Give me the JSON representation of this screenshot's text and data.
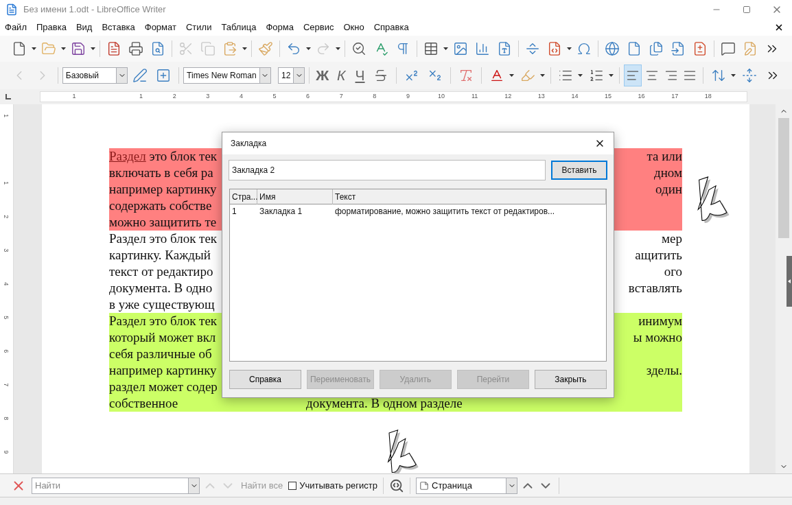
{
  "window": {
    "title": "Без имени 1.odt - LibreOffice Writer"
  },
  "menu": [
    "Файл",
    "Правка",
    "Вид",
    "Вставка",
    "Формат",
    "Стили",
    "Таблица",
    "Форма",
    "Сервис",
    "Окно",
    "Справка"
  ],
  "formatting": {
    "style": "Базовый",
    "font": "Times New Roman",
    "size": "12",
    "letters": [
      "Ж",
      "К",
      "Ч"
    ],
    "alignment": [
      {
        "kind": "left",
        "selected": true
      },
      {
        "kind": "center",
        "selected": false
      },
      {
        "kind": "right",
        "selected": false
      },
      {
        "kind": "justify",
        "selected": false
      }
    ]
  },
  "ruler": {
    "horizontal": [
      "1",
      "1",
      "2",
      "3",
      "4",
      "5",
      "6",
      "7",
      "8",
      "9",
      "10",
      "11",
      "12",
      "13",
      "14",
      "15",
      "16",
      "17",
      "18"
    ],
    "vertical": [
      "1",
      "1",
      "2",
      "3",
      "4",
      "5",
      "6",
      "7",
      "8",
      "9"
    ]
  },
  "document": {
    "blocks": [
      {
        "color": "#ff8080",
        "lines": [
          {
            "link": "Раздел",
            "left": "это блок тек",
            "right": "та или"
          },
          {
            "left": "включать в себя ра",
            "right": "дном"
          },
          {
            "left": "например картинку",
            "right": "один"
          },
          {
            "left": "содержать собстве"
          },
          {
            "left": "можно защитить те"
          }
        ]
      },
      {
        "lines": [
          {
            "left": "Раздел это блок тек",
            "right": "мер"
          },
          {
            "left": "картинку. Каждый",
            "right": "ащитить"
          },
          {
            "left": "текст от редактиро",
            "right": "ого"
          },
          {
            "left": "документа. В одно",
            "right": "вставлять"
          },
          {
            "left": "в уже существующ"
          }
        ]
      },
      {
        "color": "#ccff66",
        "lines": [
          {
            "left": "Раздел это блок тек",
            "right": "инимум"
          },
          {
            "left": "который может вкл",
            "right": "ы можно"
          },
          {
            "left": "себя различные об"
          },
          {
            "left": "например картинку",
            "right": "зделы."
          },
          {
            "left": "раздел может содер"
          },
          {
            "left": "собственное",
            "middle": "документа. В одном разделе"
          }
        ]
      }
    ]
  },
  "dialog": {
    "title": "Закладка",
    "name_value": "Закладка 2",
    "insert_button": "Вставить",
    "columns": [
      "Стра...",
      "Имя",
      "Текст"
    ],
    "rows": [
      [
        "1",
        "Закладка 1",
        "форматирование, можно защитить текст от редактиров..."
      ]
    ],
    "buttons": [
      {
        "label": "Справка",
        "disabled": false
      },
      {
        "label": "Переименовать",
        "disabled": true
      },
      {
        "label": "Удалить",
        "disabled": true
      },
      {
        "label": "Перейти",
        "disabled": true
      },
      {
        "label": "Закрыть",
        "disabled": false
      }
    ]
  },
  "find_bar": {
    "placeholder": "Найти",
    "find_all": "Найти все",
    "match_case": {
      "label": "Учитывать регистр",
      "checked": false
    },
    "scope": "Страница"
  }
}
